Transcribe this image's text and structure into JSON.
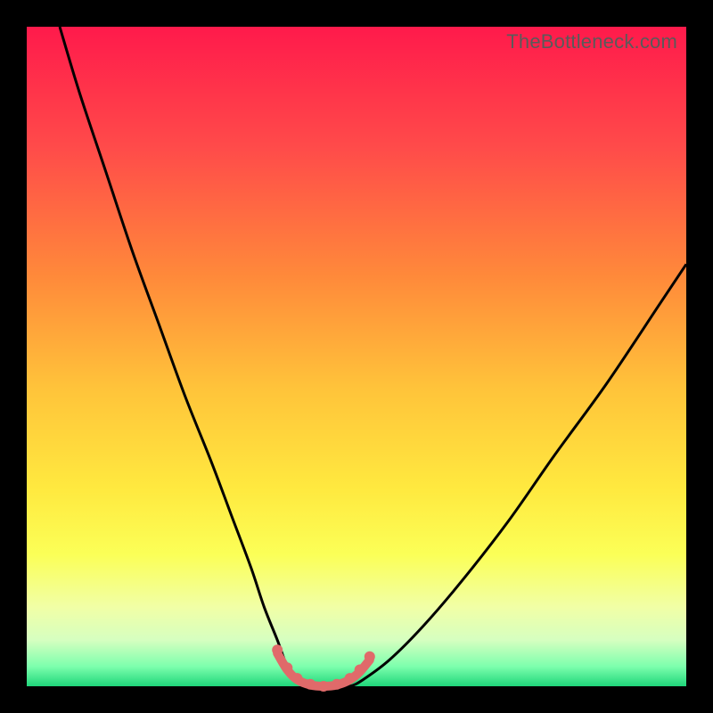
{
  "watermark": "TheBottleneck.com",
  "chart_data": {
    "type": "line",
    "title": "",
    "xlabel": "",
    "ylabel": "",
    "xlim": [
      0,
      100
    ],
    "ylim": [
      0,
      100
    ],
    "gradient_stops": [
      {
        "pct": 0,
        "color": "#ff1a4b"
      },
      {
        "pct": 18,
        "color": "#ff4a4a"
      },
      {
        "pct": 38,
        "color": "#ff8a3a"
      },
      {
        "pct": 55,
        "color": "#ffc43a"
      },
      {
        "pct": 70,
        "color": "#ffe93f"
      },
      {
        "pct": 80,
        "color": "#fbff57"
      },
      {
        "pct": 88,
        "color": "#f1ffa6"
      },
      {
        "pct": 93,
        "color": "#d6ffc0"
      },
      {
        "pct": 97,
        "color": "#7dffad"
      },
      {
        "pct": 100,
        "color": "#1fd67a"
      }
    ],
    "series": [
      {
        "name": "bottleneck-curve",
        "stroke": "#000000",
        "stroke_width": 3,
        "x": [
          5,
          8,
          12,
          16,
          20,
          24,
          28,
          31,
          34,
          36,
          38,
          39.5,
          41,
          44,
          47,
          49,
          51,
          55,
          60,
          66,
          73,
          80,
          88,
          96,
          100
        ],
        "values": [
          100,
          90,
          78,
          66,
          55,
          44,
          34,
          26,
          18,
          12,
          7,
          3,
          1,
          0,
          0,
          0,
          1,
          4,
          9,
          16,
          25,
          35,
          46,
          58,
          64
        ]
      },
      {
        "name": "valley-marker",
        "stroke": "#e06a6a",
        "stroke_width": 10,
        "x": [
          38,
          39.5,
          41,
          43,
          45,
          47,
          49,
          50.5,
          52
        ],
        "values": [
          5,
          2.5,
          1,
          0.2,
          0,
          0.2,
          1,
          2.2,
          4
        ]
      }
    ],
    "markers": {
      "name": "valley-dots",
      "fill": "#e06a6a",
      "radius": 6,
      "points": [
        {
          "x": 38,
          "y": 5.5
        },
        {
          "x": 39.5,
          "y": 2.8
        },
        {
          "x": 41,
          "y": 1.2
        },
        {
          "x": 43,
          "y": 0.3
        },
        {
          "x": 45,
          "y": 0
        },
        {
          "x": 47,
          "y": 0.3
        },
        {
          "x": 49,
          "y": 1.2
        },
        {
          "x": 50.5,
          "y": 2.5
        },
        {
          "x": 52,
          "y": 4.5
        }
      ]
    }
  }
}
